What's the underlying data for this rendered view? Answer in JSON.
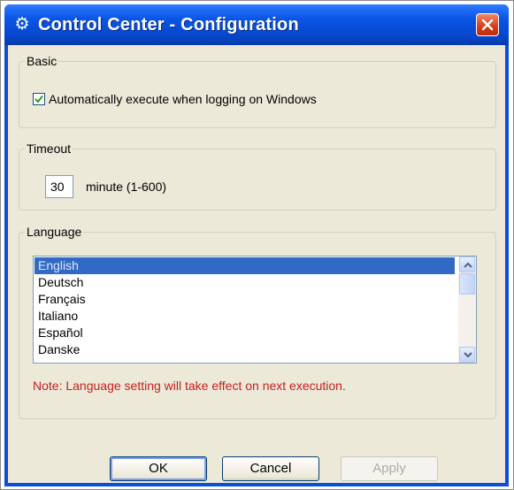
{
  "window": {
    "title": "Control Center - Configuration",
    "title_icon": "gear-icon",
    "close_icon": "close-icon"
  },
  "basic": {
    "legend": "Basic",
    "auto_execute_checked": true,
    "auto_execute_label": "Automatically execute when logging on Windows"
  },
  "timeout": {
    "legend": "Timeout",
    "value": "30",
    "unit_label": "minute (1-600)"
  },
  "language": {
    "legend": "Language",
    "items": [
      "English",
      "Deutsch",
      "Français",
      "Italiano",
      "Español",
      "Danske"
    ],
    "selected": "English",
    "note": "Note: Language setting will take effect on next execution."
  },
  "buttons": {
    "ok": "OK",
    "cancel": "Cancel",
    "apply": "Apply"
  },
  "colors": {
    "titlebar": "#0a55e6",
    "selection": "#316ac5",
    "note": "#c81e1e",
    "close": "#d63c17"
  }
}
